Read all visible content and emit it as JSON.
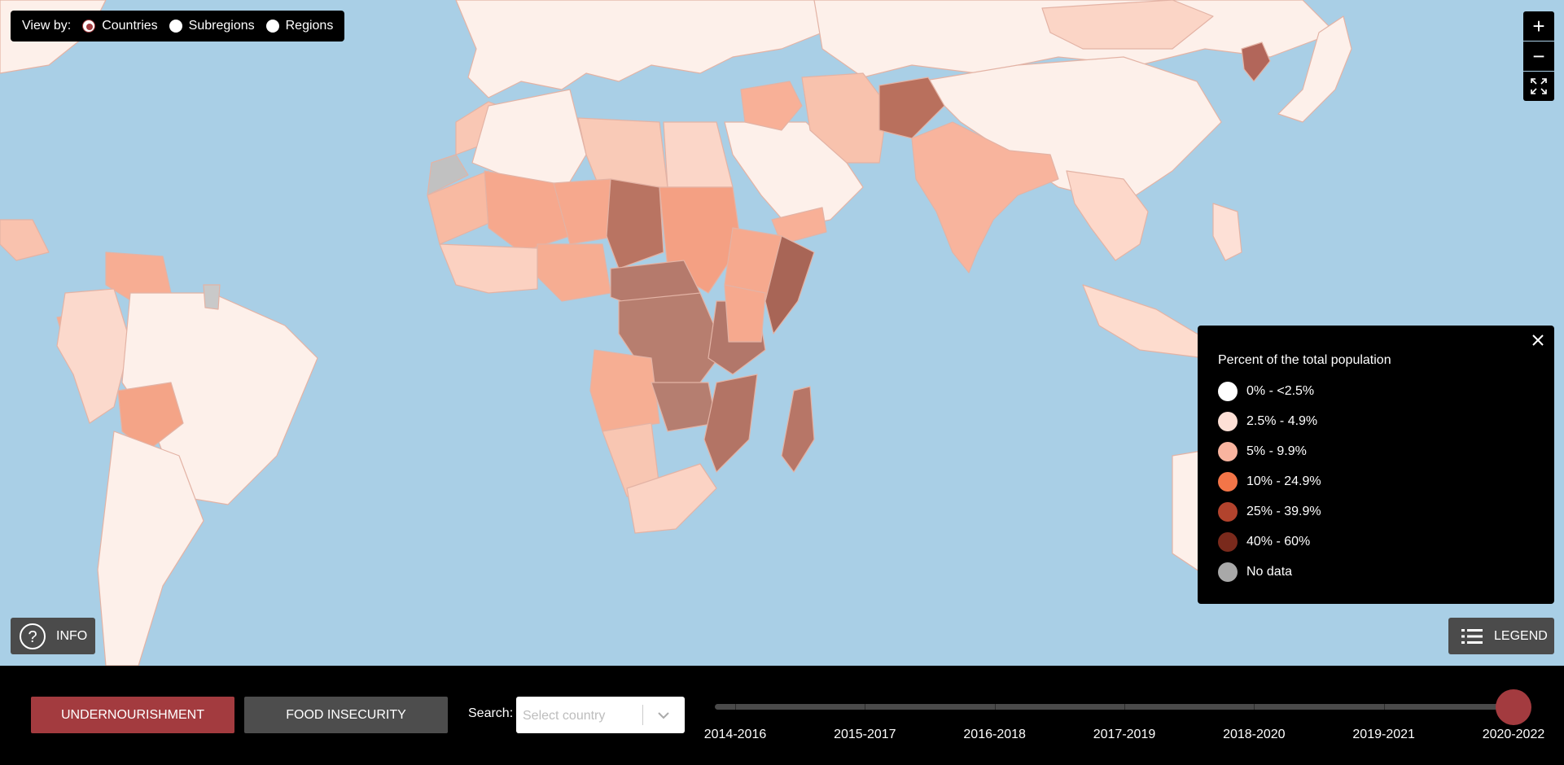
{
  "view_by": {
    "label": "View by:",
    "options": [
      {
        "label": "Countries",
        "selected": true
      },
      {
        "label": "Subregions",
        "selected": false
      },
      {
        "label": "Regions",
        "selected": false
      }
    ]
  },
  "zoom": {
    "in_symbol": "+",
    "out_symbol": "−",
    "fullscreen_icon": "fullscreen-icon"
  },
  "legend": {
    "title": "Percent of the total population",
    "items": [
      {
        "label": "0% - <2.5%",
        "color": "#ffffff"
      },
      {
        "label": "2.5% - 4.9%",
        "color": "#fde0d6"
      },
      {
        "label": "5% - 9.9%",
        "color": "#f9b49f"
      },
      {
        "label": "10% - 24.9%",
        "color": "#f37548"
      },
      {
        "label": "25% - 39.9%",
        "color": "#b2432d"
      },
      {
        "label": "40% - 60%",
        "color": "#7a2a1c"
      },
      {
        "label": "No data",
        "color": "#a8a8a8"
      }
    ]
  },
  "info_button": {
    "label": "INFO"
  },
  "legend_button": {
    "label": "LEGEND"
  },
  "tabs": {
    "undernourishment": "UNDERNOURISHMENT",
    "food_insecurity": "FOOD INSECURITY"
  },
  "search": {
    "label": "Search:",
    "placeholder": "Select country"
  },
  "timeline": {
    "periods": [
      "2014-2016",
      "2015-2017",
      "2016-2018",
      "2017-2019",
      "2018-2020",
      "2019-2021",
      "2020-2022"
    ],
    "selected": "2020-2022"
  },
  "colors": {
    "accent": "#a33b3f",
    "ocean": "#a9cfe6"
  }
}
